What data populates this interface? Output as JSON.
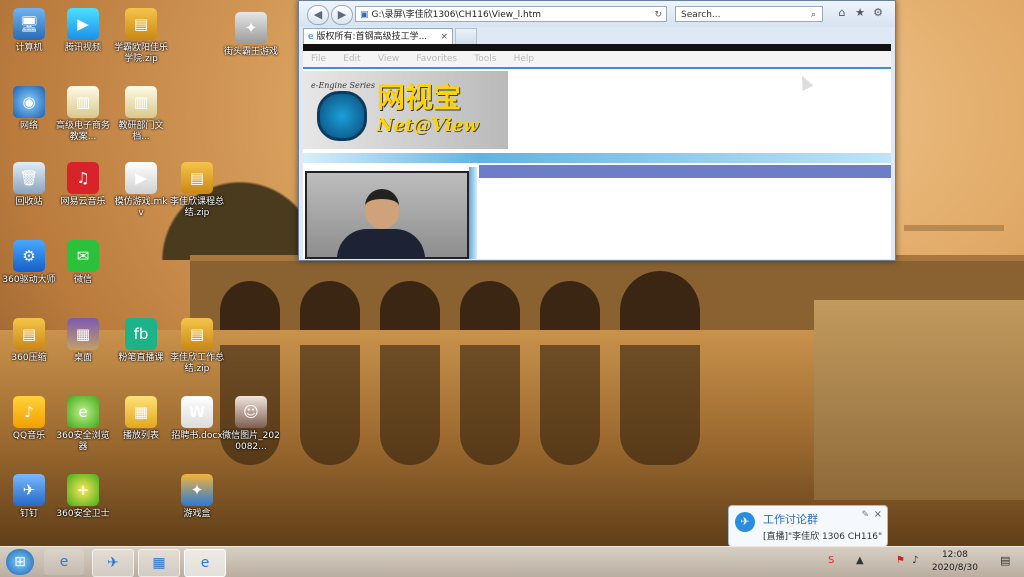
{
  "desktop": {
    "icons": [
      {
        "label": "计算机",
        "glyph": "🖥"
      },
      {
        "label": "腾讯视频",
        "glyph": "▶"
      },
      {
        "label": "学霸欧阳佳乐学院.zip",
        "glyph": "▤"
      },
      {
        "label": "街头霸王游戏",
        "glyph": "✦"
      },
      {
        "label": "网络",
        "glyph": "◉"
      },
      {
        "label": "高级电子商务教案...",
        "glyph": "▥"
      },
      {
        "label": "教研部门文档...",
        "glyph": "▥"
      },
      {
        "label": "回收站",
        "glyph": "🗑"
      },
      {
        "label": "网易云音乐",
        "glyph": "♫"
      },
      {
        "label": "模仿游戏.mkv",
        "glyph": "▶"
      },
      {
        "label": "李佳欣课程总结.zip",
        "glyph": "▤"
      },
      {
        "label": "360驱动大师",
        "glyph": "⚙"
      },
      {
        "label": "微信",
        "glyph": "✉"
      },
      {
        "label": "360压缩",
        "glyph": "▤"
      },
      {
        "label": "桌面",
        "glyph": "▦"
      },
      {
        "label": "粉笔直播课",
        "glyph": "fb"
      },
      {
        "label": "李佳欣工作总结.zip",
        "glyph": "▤"
      },
      {
        "label": "QQ音乐",
        "glyph": "♪"
      },
      {
        "label": "360安全浏览器",
        "glyph": "e"
      },
      {
        "label": "播放列表",
        "glyph": "▦"
      },
      {
        "label": "招聘书.docx",
        "glyph": "W"
      },
      {
        "label": "微信图片_2020082...",
        "glyph": "☺"
      },
      {
        "label": "钉钉",
        "glyph": "✈"
      },
      {
        "label": "360安全卫士",
        "glyph": "+"
      },
      {
        "label": "游戏盒",
        "glyph": "✦"
      }
    ]
  },
  "browser": {
    "address": "G:\\录屏\\李佳欣1306\\CH116\\View_l.htm",
    "search_placeholder": "Search...",
    "tab_title": "版权所有:首钢高级技工学...",
    "menu": [
      "File",
      "Edit",
      "View",
      "Favorites",
      "Tools",
      "Help"
    ],
    "banner_small": "e-Engine Series",
    "banner_title": "网视宝",
    "banner_sub": "Net@View"
  },
  "notification": {
    "title": "工作讨论群",
    "message": "[直播]\"李佳欣 1306 CH116\""
  },
  "taskbar": {
    "time": "12:08",
    "date": "2020/8/30"
  }
}
